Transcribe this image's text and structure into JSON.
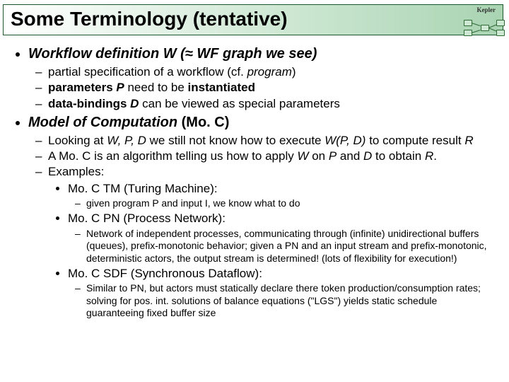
{
  "logo_text": "Kepler",
  "title": "Some Terminology (tentative)",
  "b1": {
    "head_html": "Workflow definition W (≈ WF graph we see)",
    "s1_html": "partial specification of a workflow (cf. <em class='i'>program</em>)",
    "s2_html": "<span class='b'>parameters <em class='i'>P</em></span> need to be <span class='b'>instantiated</span>",
    "s3_html": "<span class='b'>data-bindings <em class='i'>D</em></span> can be viewed as special parameters"
  },
  "b2": {
    "head_html": "Model of Computation <span class='roman'>(Mo. C)</span>",
    "s1_html": "Looking at <em class='i'>W, P, D</em> we still not know how to execute <em class='i'>W(P, D)</em>  to compute result <em class='i'>R</em>",
    "s2_html": "A Mo. C is an algorithm telling us how to apply <em class='i'>W</em> on <em class='i'>P</em> and <em class='i'>D</em> to obtain <em class='i'>R</em>.",
    "s3_label": "Examples:",
    "ex1": {
      "head": "Mo. C TM (Turing Machine):",
      "d1": "given program P and input I, we know what to do"
    },
    "ex2": {
      "head": "Mo. C PN (Process Network):",
      "d1": "Network of independent processes, communicating through (infinite) unidirectional buffers (queues), prefix-monotonic behavior; given a PN and an input stream and prefix-monotonic, deterministic actors, the output stream is determined! (lots of flexibility for execution!)"
    },
    "ex3": {
      "head": "Mo. C SDF (Synchronous Dataflow):",
      "d1": "Similar to PN, but actors must statically declare there token production/consumption rates; solving for pos. int. solutions of balance equations (\"LGS\") yields static schedule guaranteeing fixed buffer size"
    }
  }
}
